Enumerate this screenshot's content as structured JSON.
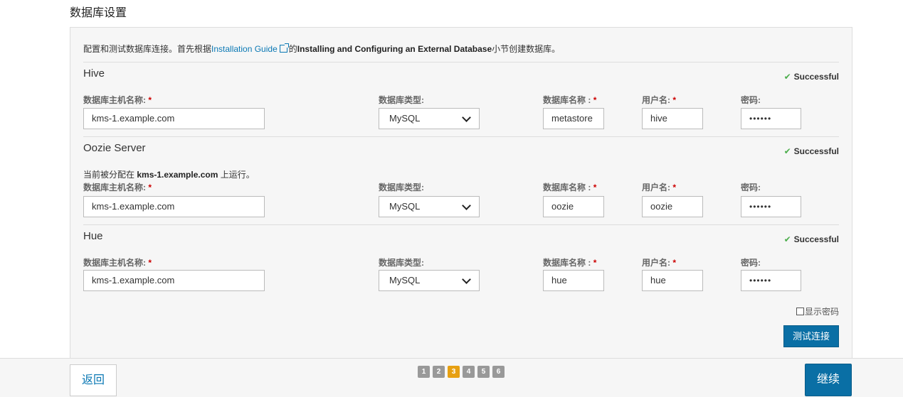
{
  "page_title": "数据库设置",
  "intro": {
    "prefix": "配置和测试数据库连接。首先根据",
    "link": "Installation Guide",
    "mid": "的",
    "bold": "Installing and Configuring an External Database",
    "suffix": "小节创建数据库。"
  },
  "labels": {
    "host": "数据库主机名称:",
    "type": "数据库类型:",
    "db_name": "数据库名称 :",
    "user": "用户名:",
    "password": "密码:",
    "required": "*"
  },
  "status_check": "✔",
  "sections": [
    {
      "title": "Hive",
      "status": "Successful",
      "host": "kms-1.example.com",
      "db_type": "MySQL",
      "db_name": "metastore",
      "user": "hive",
      "password": "••••••"
    },
    {
      "title": "Oozie Server",
      "status": "Successful",
      "note_prefix": "当前被分配在 ",
      "note_host": "kms-1.example.com",
      "note_suffix": " 上运行。",
      "host": "kms-1.example.com",
      "db_type": "MySQL",
      "db_name": "oozie",
      "user": "oozie",
      "password": "••••••"
    },
    {
      "title": "Hue",
      "status": "Successful",
      "host": "kms-1.example.com",
      "db_type": "MySQL",
      "db_name": "hue",
      "user": "hue",
      "password": "••••••"
    }
  ],
  "show_password": "显示密码",
  "test_connection": "测试连接",
  "footer": {
    "back": "返回",
    "next": "继续",
    "steps": [
      "1",
      "2",
      "3",
      "4",
      "5",
      "6"
    ],
    "current_step": 3
  }
}
